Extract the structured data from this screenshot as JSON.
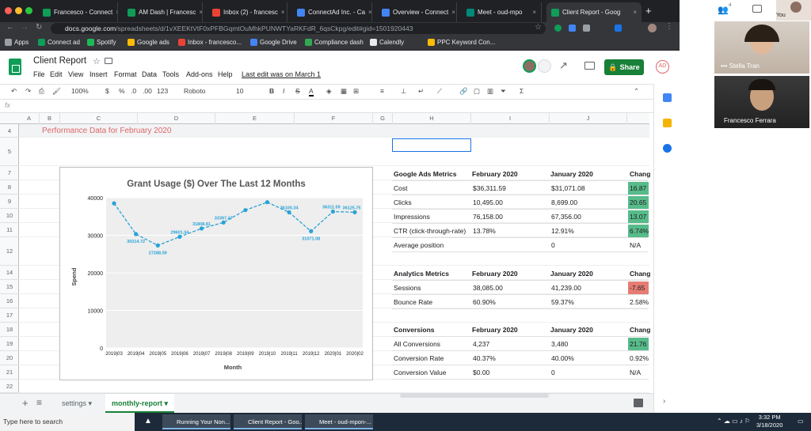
{
  "browser": {
    "tabs": [
      {
        "label": "Francesco - Connect",
        "color": "#0f9d58"
      },
      {
        "label": "AM Dash | Francesc",
        "color": "#0f9d58"
      },
      {
        "label": "Inbox (2) - francesc",
        "color": "#ea4335"
      },
      {
        "label": "ConnectAd Inc. - Ca",
        "color": "#4285f4"
      },
      {
        "label": "Overview - Connect",
        "color": "#4285f4"
      },
      {
        "label": "Meet - oud-mpo",
        "color": "#00897b"
      },
      {
        "label": "Client Report - Goog",
        "color": "#0f9d58"
      }
    ],
    "address_host": "docs.google.com",
    "address_path": "/spreadsheets/d/1vXEEKtVtF0xPFBGqmtOuMhkPUNWTYaRKFdR_6qsCkpg/edit#gid=1501920443",
    "bookmarks": [
      "Apps",
      "Connect ad",
      "Spotify",
      "Google ads",
      "Inbox - francesco...",
      "Google Drive",
      "Compliance dash",
      "Calendly",
      "PPC Keyword Con..."
    ]
  },
  "sheets": {
    "title": "Client Report",
    "menus": [
      "File",
      "Edit",
      "View",
      "Insert",
      "Format",
      "Data",
      "Tools",
      "Add-ons",
      "Help"
    ],
    "last_edit": "Last edit was on March 1",
    "share_label": "Share",
    "toolbar": {
      "zoom": "100%",
      "currency": "$",
      "percent": "%",
      "dec1": ".0",
      "dec2": ".00",
      "numfmt": "123",
      "font": "Roboto",
      "size": "10"
    },
    "fx": "fx",
    "columns": [
      "A",
      "B",
      "C",
      "D",
      "E",
      "F",
      "G",
      "H",
      "I",
      "J"
    ],
    "rows": [
      "4",
      "5",
      "7",
      "8",
      "9",
      "10",
      "11",
      "12",
      "14",
      "15",
      "16",
      "17",
      "18",
      "19",
      "20",
      "21",
      "22"
    ],
    "heading": "Performance Data for February 2020",
    "sheet_tabs": [
      "settings",
      "monthly-report"
    ]
  },
  "chart_data": {
    "type": "line",
    "title": "Grant Usage ($) Over The Last 12 Months",
    "xlabel": "Month",
    "ylabel": "Spend",
    "categories": [
      "2019|03",
      "2019|04",
      "2019|05",
      "2019|06",
      "2019|07",
      "2019|08",
      "2019|09",
      "2019|10",
      "2019|11",
      "2019|12",
      "2020|01",
      "2020|02"
    ],
    "values": [
      38500,
      30314.72,
      27288.59,
      29601.04,
      31808.81,
      33397.47,
      36700,
      38800,
      36100.34,
      31071.08,
      36311.59,
      36125.75
    ],
    "labels": [
      "",
      "30314.72",
      "27288.59",
      "29601.04",
      "31808.81",
      "33397.47",
      "",
      "",
      "36100.34",
      "31071.08",
      "36311.59",
      "36125.75"
    ],
    "yticks": [
      0,
      10000,
      20000,
      30000,
      40000
    ],
    "ylim": [
      0,
      40000
    ],
    "color": "#29a3d6"
  },
  "tables": [
    {
      "header": [
        "Google Ads Metrics",
        "February 2020",
        "January 2020",
        "Chang"
      ],
      "rows": [
        {
          "metric": "Cost",
          "feb": "$36,311.59",
          "jan": "$31,071.08",
          "chg": "16.87",
          "status": "g"
        },
        {
          "metric": "Clicks",
          "feb": "10,495.00",
          "jan": "8,699.00",
          "chg": "20.65",
          "status": "g"
        },
        {
          "metric": "Impressions",
          "feb": "76,158.00",
          "jan": "67,356.00",
          "chg": "13.07",
          "status": "g"
        },
        {
          "metric": "CTR (click-through-rate)",
          "feb": "13.78%",
          "jan": "12.91%",
          "chg": "6.74%",
          "status": "g"
        },
        {
          "metric": "Average position",
          "feb": "",
          "jan": "0",
          "chg": "N/A",
          "status": ""
        }
      ]
    },
    {
      "header": [
        "Analytics Metrics",
        "February 2020",
        "January 2020",
        "Chang"
      ],
      "rows": [
        {
          "metric": "Sessions",
          "feb": "38,085.00",
          "jan": "41,239.00",
          "chg": "-7.65",
          "status": "r"
        },
        {
          "metric": "Bounce Rate",
          "feb": "60.90%",
          "jan": "59.37%",
          "chg": "2.58%",
          "status": ""
        }
      ]
    },
    {
      "header": [
        "Conversions",
        "February 2020",
        "January 2020",
        "Chang"
      ],
      "rows": [
        {
          "metric": "All Conversions",
          "feb": "4,237",
          "jan": "3,480",
          "chg": "21.76",
          "status": "g"
        },
        {
          "metric": "Conversion Rate",
          "feb": "40.37%",
          "jan": "40.00%",
          "chg": "0.92%",
          "status": ""
        },
        {
          "metric": "Conversion Value",
          "feb": "$0.00",
          "jan": "0",
          "chg": "N/A",
          "status": ""
        }
      ]
    }
  ],
  "meet": {
    "you": "You",
    "participants": [
      "Stella Tran",
      "Francesco Ferrara"
    ],
    "people_count": "4"
  },
  "taskbar": {
    "search": "Type here to search",
    "tasks": [
      "Running Your Non...",
      "Client Report - Goo...",
      "Meet - oud-mpon-..."
    ],
    "time": "3:32 PM",
    "date": "3/18/2020"
  }
}
